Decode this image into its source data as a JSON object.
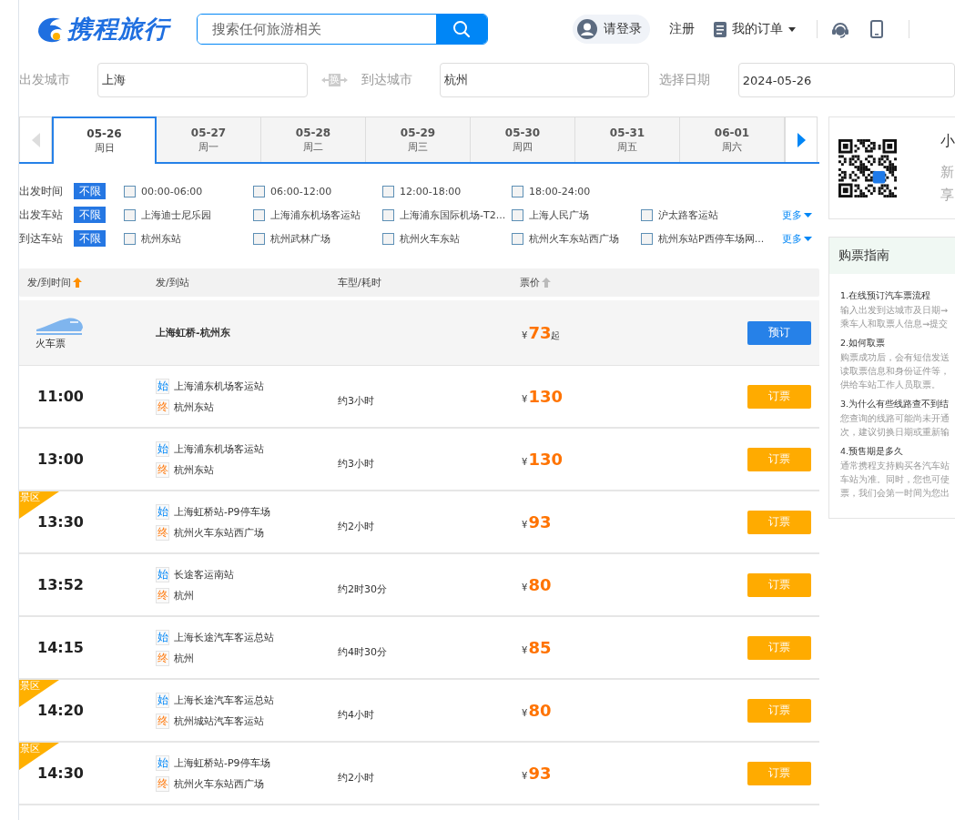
{
  "header": {
    "logo": "携程旅行",
    "search": {
      "placeholder": "搜索任何旅游相关"
    },
    "login": "请登录",
    "register": "注册",
    "orders": "我的订单"
  },
  "search_bar": [
    {
      "label": "出发城市",
      "value": "上海"
    },
    {
      "label": "到达城市",
      "value": "杭州"
    },
    {
      "label": "选择日期",
      "value": "2024-05-26"
    }
  ],
  "swap_label": "换",
  "date_tabs": [
    {
      "date": "05-26",
      "weekday": "周日",
      "selected": true
    },
    {
      "date": "05-27",
      "weekday": "周一",
      "selected": false
    },
    {
      "date": "05-28",
      "weekday": "周二",
      "selected": false
    },
    {
      "date": "05-29",
      "weekday": "周三",
      "selected": false
    },
    {
      "date": "05-30",
      "weekday": "周四",
      "selected": false
    },
    {
      "date": "05-31",
      "weekday": "周五",
      "selected": false
    },
    {
      "date": "06-01",
      "weekday": "周六",
      "selected": false
    }
  ],
  "filters": [
    {
      "label": "出发时间",
      "all": "不限",
      "options": [
        {
          "label": "00:00-06:00",
          "checked": false
        },
        {
          "label": "06:00-12:00",
          "checked": false
        },
        {
          "label": "12:00-18:00",
          "checked": false
        },
        {
          "label": "18:00-24:00",
          "checked": false
        }
      ]
    },
    {
      "label": "出发车站",
      "all": "不限",
      "options": [
        {
          "label": "上海迪士尼乐园",
          "checked": false
        },
        {
          "label": "上海浦东机场客运站",
          "checked": false
        },
        {
          "label": "上海浦东国际机场-T2...",
          "checked": false
        },
        {
          "label": "上海人民广场",
          "checked": false
        },
        {
          "label": "沪太路客运站",
          "checked": false
        }
      ],
      "more": "更多"
    },
    {
      "label": "到达车站",
      "all": "不限",
      "options": [
        {
          "label": "杭州东站",
          "checked": false
        },
        {
          "label": "杭州武林广场",
          "checked": false
        },
        {
          "label": "杭州火车东站",
          "checked": false
        },
        {
          "label": "杭州火车东站西广场",
          "checked": false
        },
        {
          "label": "杭州东站P西停车场网...",
          "checked": false
        }
      ],
      "more": "更多"
    }
  ],
  "table": {
    "columns": [
      {
        "label": "发/到时间",
        "sort_active": true
      },
      {
        "label": "发/到站"
      },
      {
        "label": "车型/耗时"
      },
      {
        "label": "票价",
        "sort_active": false
      }
    ],
    "train_row": {
      "label": "火车票",
      "route": "上海虹桥-杭州东",
      "currency": "¥",
      "price": "73",
      "suffix": "起",
      "button": "预订"
    },
    "rows": [
      {
        "time": "11:00",
        "stops": [
          {
            "kind": "start",
            "tag": "始",
            "name": "上海浦东机场客运站"
          },
          {
            "kind": "end",
            "tag": "终",
            "name": "杭州东站"
          }
        ],
        "duration": "约3小时",
        "currency": "¥",
        "price": "130",
        "button": "订票"
      },
      {
        "time": "13:00",
        "stops": [
          {
            "kind": "start",
            "tag": "始",
            "name": "上海浦东机场客运站"
          },
          {
            "kind": "end",
            "tag": "终",
            "name": "杭州东站"
          }
        ],
        "duration": "约3小时",
        "currency": "¥",
        "price": "130",
        "button": "订票"
      },
      {
        "badge": "景区",
        "time": "13:30",
        "stops": [
          {
            "kind": "start",
            "tag": "始",
            "name": "上海虹桥站-P9停车场"
          },
          {
            "kind": "end",
            "tag": "终",
            "name": "杭州火车东站西广场"
          }
        ],
        "duration": "约2小时",
        "currency": "¥",
        "price": "93",
        "button": "订票"
      },
      {
        "time": "13:52",
        "stops": [
          {
            "kind": "start",
            "tag": "始",
            "name": "长途客运南站"
          },
          {
            "kind": "end",
            "tag": "终",
            "name": "杭州"
          }
        ],
        "duration": "约2时30分",
        "currency": "¥",
        "price": "80",
        "button": "订票"
      },
      {
        "time": "14:15",
        "stops": [
          {
            "kind": "start",
            "tag": "始",
            "name": "上海长途汽车客运总站"
          },
          {
            "kind": "end",
            "tag": "终",
            "name": "杭州"
          }
        ],
        "duration": "约4时30分",
        "currency": "¥",
        "price": "85",
        "button": "订票"
      },
      {
        "badge": "景区",
        "time": "14:20",
        "stops": [
          {
            "kind": "start",
            "tag": "始",
            "name": "上海长途汽车客运总站"
          },
          {
            "kind": "end",
            "tag": "终",
            "name": "杭州城站汽车客运站"
          }
        ],
        "duration": "约4小时",
        "currency": "¥",
        "price": "80",
        "button": "订票"
      },
      {
        "badge": "景区",
        "time": "14:30",
        "stops": [
          {
            "kind": "start",
            "tag": "始",
            "name": "上海虹桥站-P9停车场"
          },
          {
            "kind": "end",
            "tag": "终",
            "name": "杭州火车东站西广场"
          }
        ],
        "duration": "约2小时",
        "currency": "¥",
        "price": "93",
        "button": "订票"
      }
    ]
  },
  "sidebar": {
    "app_card": {
      "title": "小",
      "lines": [
        "新",
        "享"
      ]
    },
    "guide": {
      "title": "购票指南",
      "items": [
        {
          "title": "1.在线预订汽车票流程",
          "lines": [
            "输入出发到达城市及日期→",
            "乘车人和取票人信息→提交"
          ]
        },
        {
          "title": "2.如何取票",
          "lines": [
            "购票成功后，会有短信发送",
            "读取票信息和身份证件等，",
            "供给车站工作人员取票。"
          ]
        },
        {
          "title": "3.为什么有些线路查不到结",
          "lines": [
            "您查询的线路可能尚未开通",
            "次，建议切换日期或重新输"
          ]
        },
        {
          "title": "4.预售期是多久",
          "lines": [
            "通常携程支持购买各汽车站",
            "车站为准。同时，您也可使",
            "票，我们会第一时间为您出"
          ]
        }
      ]
    }
  }
}
